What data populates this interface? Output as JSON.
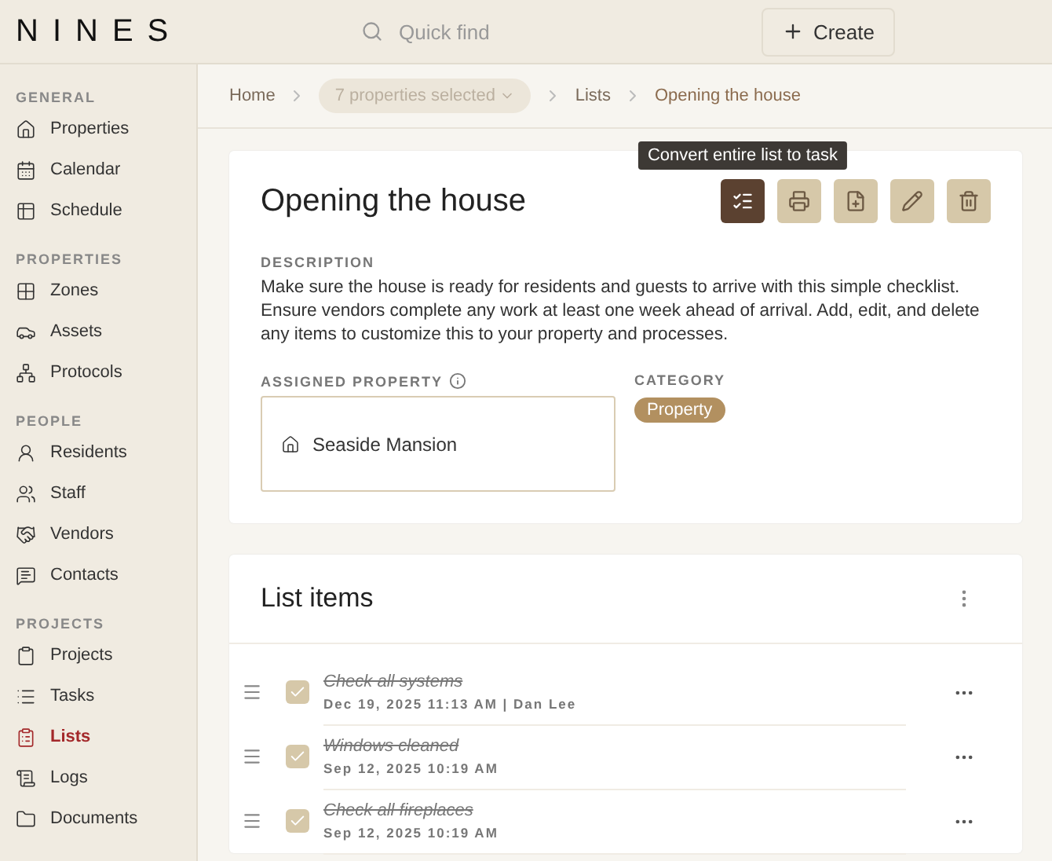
{
  "header": {
    "logo": "NINES",
    "search": {
      "placeholder": "Quick find"
    },
    "create_button": "Create"
  },
  "sidebar": {
    "sections": [
      {
        "title": "GENERAL",
        "items": [
          {
            "label": "Properties",
            "selected": false
          },
          {
            "label": "Calendar",
            "selected": false
          },
          {
            "label": "Schedule",
            "selected": false
          }
        ]
      },
      {
        "title": "PROPERTIES",
        "items": [
          {
            "label": "Zones",
            "selected": false
          },
          {
            "label": "Assets",
            "selected": false
          },
          {
            "label": "Protocols",
            "selected": false
          }
        ]
      },
      {
        "title": "PEOPLE",
        "items": [
          {
            "label": "Residents",
            "selected": false
          },
          {
            "label": "Staff",
            "selected": false
          },
          {
            "label": "Vendors",
            "selected": false
          },
          {
            "label": "Contacts",
            "selected": false
          }
        ]
      },
      {
        "title": "PROJECTS",
        "items": [
          {
            "label": "Projects",
            "selected": false
          },
          {
            "label": "Tasks",
            "selected": false
          },
          {
            "label": "Lists",
            "selected": true
          },
          {
            "label": "Logs",
            "selected": false
          },
          {
            "label": "Documents",
            "selected": false
          }
        ]
      }
    ]
  },
  "breadcrumb": {
    "home": "Home",
    "property_select": {
      "placeholder": "7 properties selected"
    },
    "lists": "Lists",
    "current": "Opening the house"
  },
  "detail": {
    "title": "Opening the house",
    "tooltip": "Convert entire list to task",
    "description_label": "DESCRIPTION",
    "description": "Make sure the house is ready for residents and guests to arrive with this simple checklist. Ensure vendors complete any work at least one week ahead of arrival. Add, edit, and delete any items to customize this to your property and processes.",
    "assigned_property_label": "ASSIGNED PROPERTY",
    "assigned_property": "Seaside Mansion",
    "category_label": "CATEGORY",
    "category": "Property"
  },
  "list": {
    "title": "List items",
    "items": [
      {
        "label": "Check all systems",
        "meta": "Dec 19, 2025 11:13 AM | Dan Lee",
        "checked": true
      },
      {
        "label": "Windows cleaned",
        "meta": "Sep 12, 2025 10:19 AM",
        "checked": true
      },
      {
        "label": "Check all fireplaces",
        "meta": "Sep 12, 2025 10:19 AM",
        "checked": true
      }
    ]
  }
}
